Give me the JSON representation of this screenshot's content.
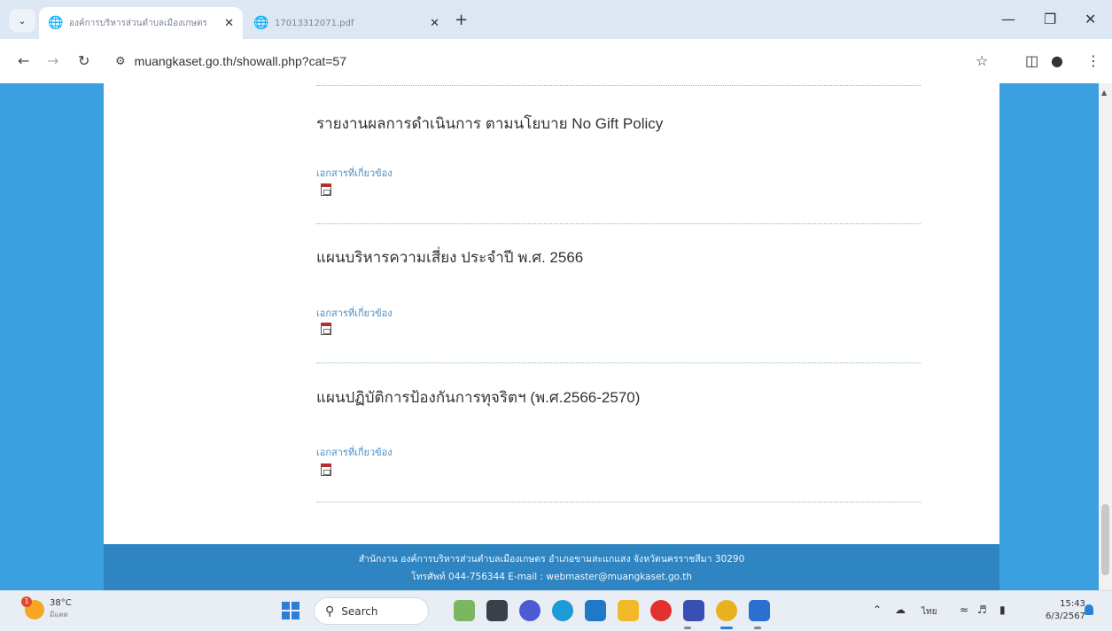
{
  "browser": {
    "tabs": [
      {
        "title": "องค์การบริหารส่วนตำบลเมืองเกษตร",
        "active": true
      },
      {
        "title": "17013312071.pdf",
        "active": false
      }
    ],
    "url": "muangkaset.go.th/showall.php?cat=57"
  },
  "page": {
    "items": [
      {
        "title": "รายงานผลการดำเนินการ ตามนโยบาย No Gift Policy",
        "doc_label": "เอกสารที่เกี่ยวข้อง"
      },
      {
        "title": "แผนบริหารความเสี่ยง ประจำปี พ.ศ. 2566",
        "doc_label": "เอกสารที่เกี่ยวข้อง"
      },
      {
        "title": "แผนปฏิบัติการป้องกันการทุจริตฯ (พ.ศ.2566-2570)",
        "doc_label": "เอกสารที่เกี่ยวข้อง"
      }
    ],
    "footer": {
      "line1": "สำนักงาน องค์การบริหารส่วนตำบลเมืองเกษตร อำเภอขามสะแกแสง จังหวัดนครราชสีมา 30290",
      "line2": "โทรศัพท์ 044-756344 E-mail : webmaster@muangkaset.go.th"
    }
  },
  "taskbar": {
    "weather_temp": "38°C",
    "weather_cond": "มีแดด",
    "weather_alert": "1",
    "search_label": "Search",
    "language": "ไทย",
    "time": "15:43",
    "date": "6/3/2567"
  },
  "colors": {
    "page_background": "#3aa0e0",
    "footer": "#2e85c2",
    "doc_link": "#4a8fc7"
  }
}
